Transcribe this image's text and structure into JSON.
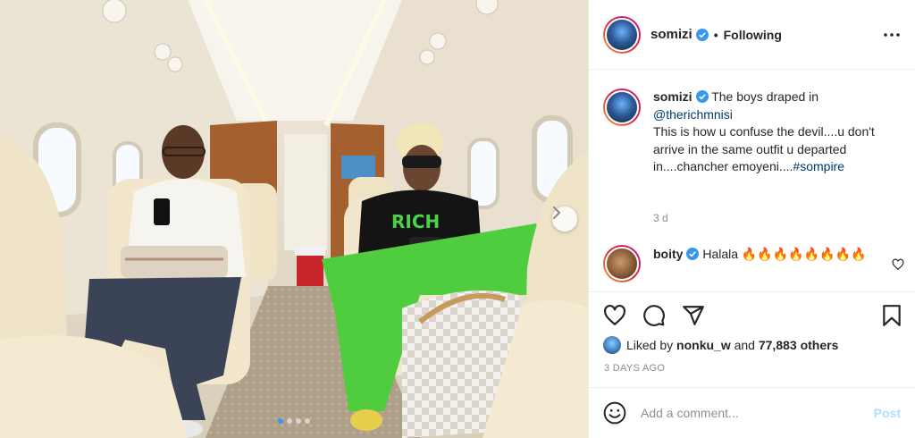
{
  "post": {
    "author": "somizi",
    "follow_separator": "•",
    "follow_status": "Following",
    "caption_text_1": "The boys draped in",
    "caption_mention": "@therichmnisi",
    "caption_text_2": "This is how u confuse the devil....u don't arrive in the same outfit u departed in....chancher emoyeni....",
    "caption_hashtag": "#sompire",
    "relative_time": "3 d",
    "likes_prefix": "Liked by",
    "liked_by_user": "nonku_w",
    "likes_and": "and",
    "likes_count": "77,883 others",
    "date": "3 DAYS AGO"
  },
  "comments": [
    {
      "user": "boity",
      "text": "Halala 🔥🔥🔥🔥🔥🔥🔥🔥"
    }
  ],
  "add_comment": {
    "placeholder": "Add a comment...",
    "post_label": "Post"
  },
  "carousel": {
    "total": 4,
    "active_index": 0
  },
  "photo": {
    "shirt_text": "RICH"
  },
  "icons": [
    "verified-badge-icon",
    "more-options-icon",
    "heart-icon",
    "comment-icon",
    "share-icon",
    "bookmark-icon",
    "emoji-icon",
    "next-arrow-icon"
  ],
  "colors": {
    "link": "#00376b",
    "verified": "#3897f0",
    "post_disabled": "#b2dffc",
    "muted": "#8e8e8e"
  }
}
